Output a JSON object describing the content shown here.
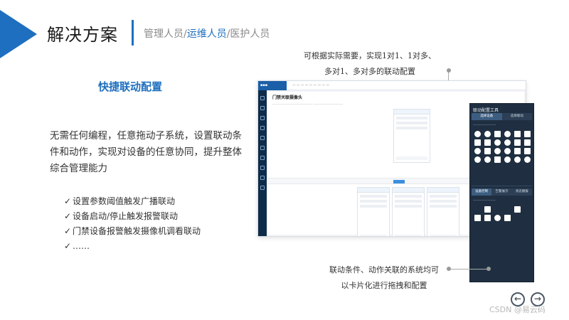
{
  "header": {
    "title": "解决方案",
    "subtitle_parts": [
      "管理人员/",
      "运维人员",
      "/医护人员"
    ]
  },
  "section": {
    "title": "快捷联动配置",
    "description": "无需任何编程，任意拖动子系统，设置联动条件和动作，实现对设备的任意协同，提升整体综合管理能力",
    "bullets": [
      "设置参数阈值触发广播联动",
      "设备启动/停止触发报警联动",
      "门禁设备报警触发摄像机调看联动",
      "……"
    ]
  },
  "callouts": {
    "top_line1": "可根据实际需要，实现1对1、1对多、",
    "top_line2": "多对1、多对多的联动配置",
    "bottom_line1": "联动条件、动作关联的系统均可",
    "bottom_line2": "以卡片化进行拖拽和配置"
  },
  "screenshot": {
    "window_title": "门禁关联摄像头",
    "panel_title": "联动配置工具",
    "panel_tabs": [
      "选择设备",
      "选择联动"
    ],
    "panel_tabs_lower": [
      "设备控制",
      "告警展示",
      "状态播报"
    ]
  },
  "nav": {
    "prev": "←",
    "next": "→"
  },
  "watermark": "CSDN @易云码",
  "colors": {
    "accent": "#1e6fbf",
    "panel_bg": "#1f2f41",
    "sidebar_bg": "#0e2c4a"
  }
}
